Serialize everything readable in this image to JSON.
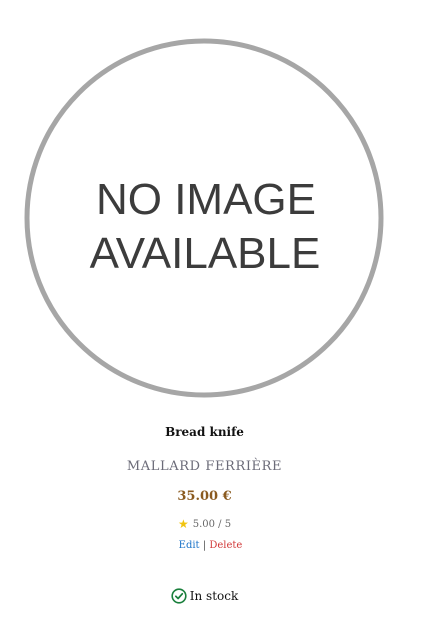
{
  "product": {
    "image_text_line1": "NO IMAGE",
    "image_text_line2": "AVAILABLE",
    "name": "Bread knife",
    "brand": "MALLARD FERRIÈRE",
    "price": "35.00 €",
    "rating_text": "5.00 / 5",
    "rating_value": 5.0,
    "rating_max": 5
  },
  "actions": {
    "edit_label": "Edit",
    "separator": "|",
    "delete_label": "Delete"
  },
  "stock": {
    "label": "In stock"
  },
  "colors": {
    "price": "#8a5a1f",
    "edit_link": "#1a73c8",
    "delete_link": "#d23c3c",
    "star": "#f1c40f",
    "stock_icon": "#1a7f3c"
  },
  "icons": {
    "rating": "star-icon",
    "stock": "check-circle-icon"
  }
}
